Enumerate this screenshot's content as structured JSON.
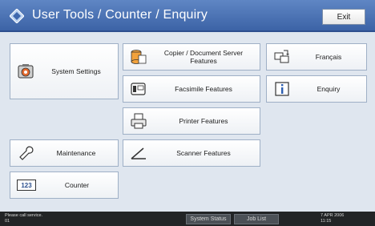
{
  "header": {
    "title": "User Tools / Counter / Enquiry",
    "exit_label": "Exit"
  },
  "tiles": {
    "system_settings": "System Settings",
    "copier": "Copier / Document Server Features",
    "francais": "Français",
    "facsimile": "Facsimile Features",
    "enquiry": "Enquiry",
    "printer": "Printer Features",
    "maintenance": "Maintenance",
    "scanner": "Scanner Features",
    "counter": "Counter",
    "counter_icon_text": "123"
  },
  "statusbar": {
    "message_line1": "Please call service.",
    "message_line2": "01",
    "system_status_label": "System Status",
    "job_list_label": "Job List",
    "date": "7 APR  2006",
    "time": "11:15"
  },
  "colors": {
    "header": "#4a72b6",
    "background": "#dfe6ef",
    "statusbar": "#222426"
  }
}
